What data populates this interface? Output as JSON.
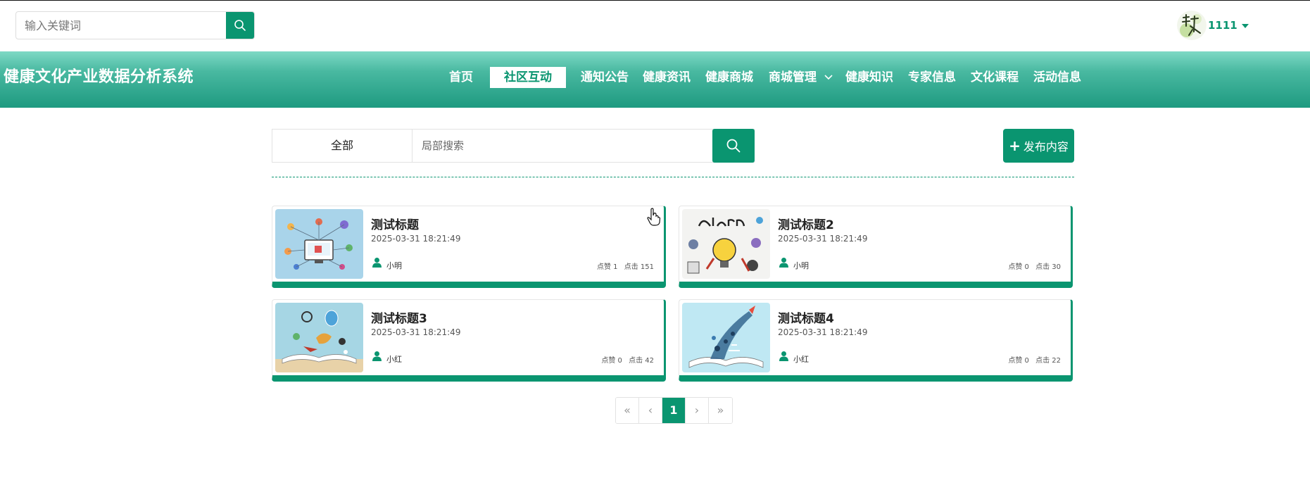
{
  "topbar": {
    "search_placeholder": "输入关键词",
    "username": "1111"
  },
  "header": {
    "site_title": "健康文化产业数据分析系统"
  },
  "nav": {
    "items": [
      {
        "label": "首页"
      },
      {
        "label": "社区互动",
        "active": true
      },
      {
        "label": "通知公告"
      },
      {
        "label": "健康资讯"
      },
      {
        "label": "健康商城"
      },
      {
        "label": "商城管理"
      },
      {
        "label": "健康知识"
      },
      {
        "label": "专家信息"
      },
      {
        "label": "文化课程"
      },
      {
        "label": "活动信息"
      }
    ]
  },
  "filter": {
    "category": "全部",
    "search_placeholder": "局部搜索",
    "publish_label": "发布内容"
  },
  "posts": [
    {
      "title": "测试标题",
      "date": "2025-03-31 18:21:49",
      "author": "小明",
      "likes": "点赞 1",
      "clicks": "点击 151"
    },
    {
      "title": "测试标题2",
      "date": "2025-03-31 18:21:49",
      "author": "小明",
      "likes": "点赞 0",
      "clicks": "点击 30"
    },
    {
      "title": "测试标题3",
      "date": "2025-03-31 18:21:49",
      "author": "小红",
      "likes": "点赞 0",
      "clicks": "点击 42"
    },
    {
      "title": "测试标题4",
      "date": "2025-03-31 18:21:49",
      "author": "小红",
      "likes": "点赞 0",
      "clicks": "点击 22"
    }
  ],
  "pagination": {
    "first": "«",
    "prev": "‹",
    "current": "1",
    "next": "›",
    "last": "»"
  },
  "colors": {
    "accent": "#0a9570",
    "nav_gradient_top": "#7ed9c5",
    "nav_gradient_bottom": "#1e9a80"
  }
}
